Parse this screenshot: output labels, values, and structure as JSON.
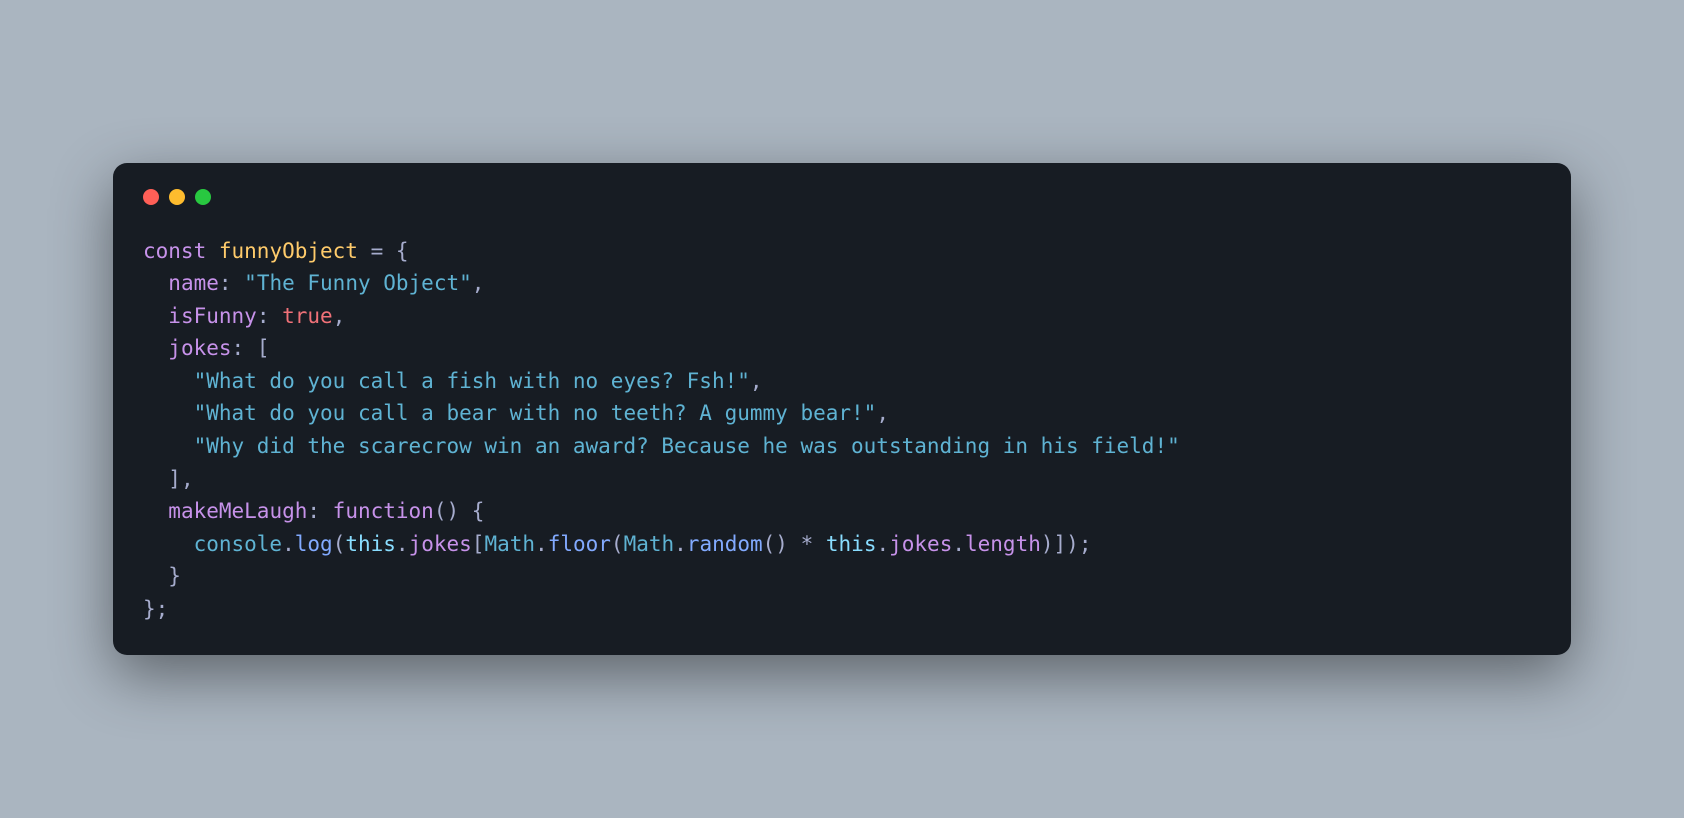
{
  "window": {
    "controls": {
      "close_color": "#ff5f57",
      "minimize_color": "#febc2e",
      "maximize_color": "#28c840"
    }
  },
  "code": {
    "keyword_const": "const",
    "variable_name": "funnyObject",
    "equals": " = ",
    "brace_open": "{",
    "prop_name": "name",
    "colon": ": ",
    "name_value": "\"The Funny Object\"",
    "comma": ",",
    "prop_isFunny": "isFunny",
    "isFunny_value": "true",
    "prop_jokes": "jokes",
    "bracket_open": "[",
    "joke1": "\"What do you call a fish with no eyes? Fsh!\"",
    "joke2": "\"What do you call a bear with no teeth? A gummy bear!\"",
    "joke3": "\"Why did the scarecrow win an award? Because he was outstanding in his field!\"",
    "bracket_close": "]",
    "prop_makeMeLaugh": "makeMeLaugh",
    "keyword_function": "function",
    "paren_pair": "()",
    "space": " ",
    "console": "console",
    "dot": ".",
    "log": "log",
    "paren_open": "(",
    "this": "this",
    "jokes_ref": "jokes",
    "bracket_open2": "[",
    "math": "Math",
    "floor": "floor",
    "random": "random",
    "star": " * ",
    "length": "length",
    "paren_close": ")",
    "bracket_close2": "]",
    "semicolon": ";",
    "brace_close": "}",
    "brace_close_semi": "};"
  }
}
